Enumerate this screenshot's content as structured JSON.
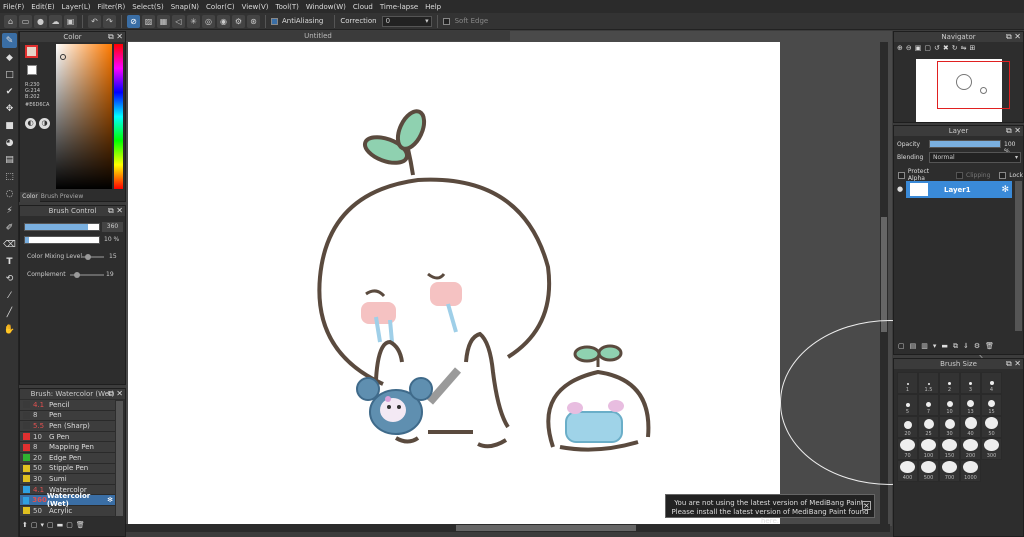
{
  "menu": [
    "File(F)",
    "Edit(E)",
    "Layer(L)",
    "Filter(R)",
    "Select(S)",
    "Snap(N)",
    "Color(C)",
    "View(V)",
    "Tool(T)",
    "Window(W)",
    "Cloud",
    "Time-lapse",
    "Help"
  ],
  "toolbar": {
    "antialias_label": "AntiAliasing",
    "correction_label": "Correction",
    "correction_value": "0",
    "soft_edge_label": "Soft Edge"
  },
  "color_panel": {
    "title": "Color",
    "r": "R:230",
    "g": "G:214",
    "b": "B:202",
    "hex": "#E6D6CA",
    "tab_color": "Color",
    "tab_preview": "Brush Preview",
    "foreground": "#e6d6ca"
  },
  "brush_control": {
    "title": "Brush Control",
    "size_value": "360",
    "opacity_value": "10 %",
    "mixing_label": "Color Mixing Level",
    "mixing_value": "15",
    "complement_label": "Complement",
    "complement_value": "19",
    "size_fill": 0.85,
    "opacity_fill": 0.06
  },
  "brush_list": {
    "title": "Brush: Watercolor (Wet)",
    "items": [
      {
        "size": "4.1",
        "name": "Pencil",
        "color": "#3a3a3a",
        "num_color": "#e05050"
      },
      {
        "size": "8",
        "name": "Pen",
        "color": "#3a3a3a",
        "num_color": "#ccc"
      },
      {
        "size": "5.5",
        "name": "Pen (Sharp)",
        "color": "#3a3a3a",
        "num_color": "#e05050"
      },
      {
        "size": "10",
        "name": "G Pen",
        "color": "#e03030",
        "num_color": "#ccc"
      },
      {
        "size": "8",
        "name": "Mapping Pen",
        "color": "#e03030",
        "num_color": "#ccc"
      },
      {
        "size": "20",
        "name": "Edge Pen",
        "color": "#30b030",
        "num_color": "#ccc"
      },
      {
        "size": "50",
        "name": "Stipple Pen",
        "color": "#e0c020",
        "num_color": "#ccc"
      },
      {
        "size": "30",
        "name": "Sumi",
        "color": "#e0c020",
        "num_color": "#ccc"
      },
      {
        "size": "4.1",
        "name": "Watercolor",
        "color": "#30a0e0",
        "num_color": "#e05050"
      },
      {
        "size": "360",
        "name": "Watercolor (Wet)",
        "color": "#30a0e0",
        "num_color": "#e05050"
      },
      {
        "size": "50",
        "name": "Acrylic",
        "color": "#e0c020",
        "num_color": "#ccc"
      }
    ]
  },
  "canvas": {
    "title": "Untitled"
  },
  "notice": {
    "line1": "You are not using the latest version of MediBang Paint.",
    "line2": "Please install the latest version of MediBang Paint found here."
  },
  "navigator": {
    "title": "Navigator"
  },
  "layer_panel": {
    "title": "Layer",
    "opacity_label": "Opacity",
    "opacity_value": "100 %",
    "blending_label": "Blending",
    "blending_value": "Normal",
    "protect_alpha": "Protect Alpha",
    "clipping": "Clipping",
    "lock": "Lock",
    "layer_name": "Layer1"
  },
  "brush_size": {
    "title": "Brush Size",
    "sizes": [
      "1",
      "1.5",
      "2",
      "3",
      "4",
      "5",
      "7",
      "10",
      "13",
      "15",
      "20",
      "25",
      "30",
      "40",
      "50",
      "70",
      "100",
      "150",
      "200",
      "300",
      "400",
      "500",
      "700",
      "1000"
    ]
  }
}
